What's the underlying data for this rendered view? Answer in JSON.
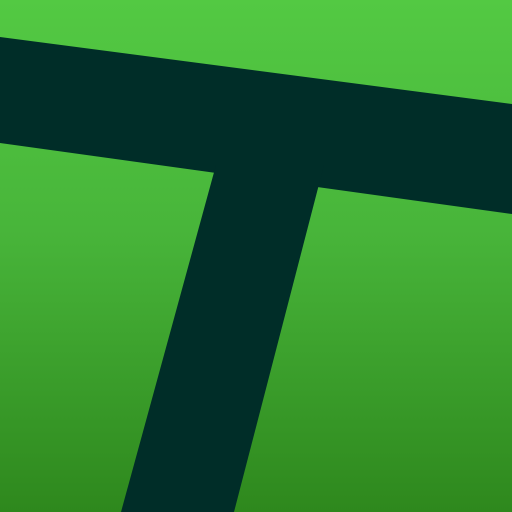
{
  "icon": {
    "name": "app-icon",
    "glyph": "T-logo-icon",
    "colors": {
      "background_top": "#53c943",
      "background_bottom": "#2e881d",
      "glyph": "#002d28"
    }
  }
}
